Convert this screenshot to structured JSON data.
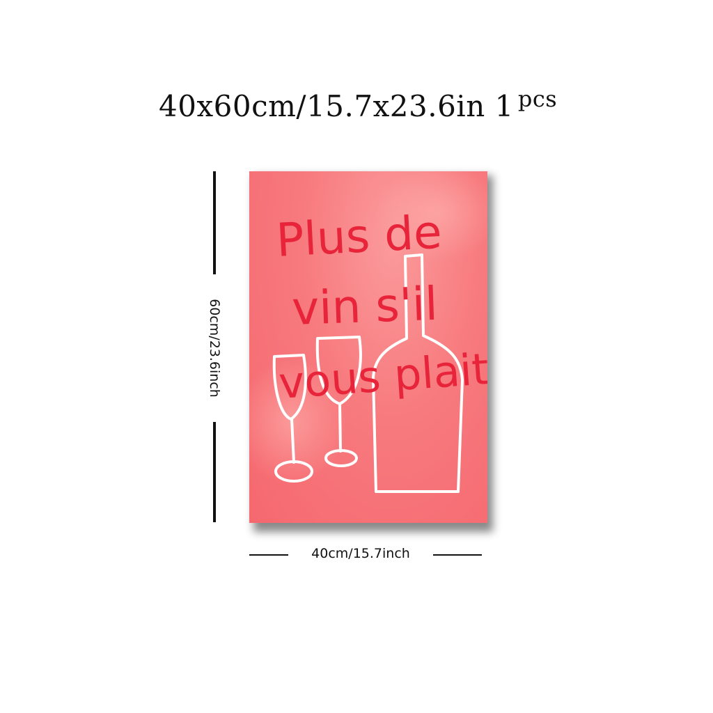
{
  "header": {
    "size_text": "40x60cm/15.7x23.6in 1",
    "quantity_suffix": "pcs"
  },
  "dimensions": {
    "height_label": "60cm/23.6inch",
    "width_label": "40cm/15.7inch"
  },
  "poster": {
    "text_line_1": "Plus de",
    "text_line_2": "vin s'il",
    "text_line_3": "vous plait",
    "background_color": "#f77a7e",
    "text_color": "#e8243a",
    "drawing_color": "#ffffff",
    "drawing_items": [
      "wine-glass-icon",
      "wine-glass-icon",
      "wine-bottle-icon"
    ]
  }
}
